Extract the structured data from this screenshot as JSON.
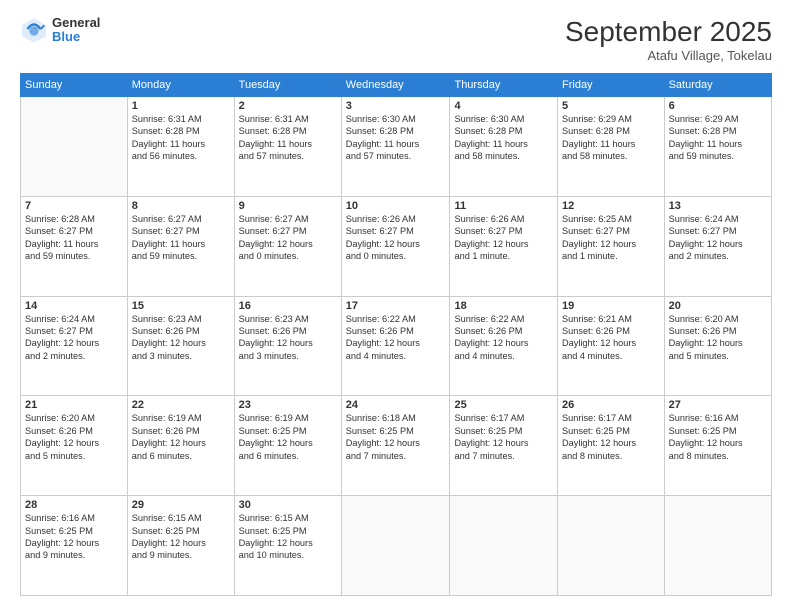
{
  "header": {
    "logo": {
      "general": "General",
      "blue": "Blue"
    },
    "title": "September 2025",
    "subtitle": "Atafu Village, Tokelau"
  },
  "weekdays": [
    "Sunday",
    "Monday",
    "Tuesday",
    "Wednesday",
    "Thursday",
    "Friday",
    "Saturday"
  ],
  "weeks": [
    [
      {
        "day": "",
        "info": ""
      },
      {
        "day": "1",
        "info": "Sunrise: 6:31 AM\nSunset: 6:28 PM\nDaylight: 11 hours\nand 56 minutes."
      },
      {
        "day": "2",
        "info": "Sunrise: 6:31 AM\nSunset: 6:28 PM\nDaylight: 11 hours\nand 57 minutes."
      },
      {
        "day": "3",
        "info": "Sunrise: 6:30 AM\nSunset: 6:28 PM\nDaylight: 11 hours\nand 57 minutes."
      },
      {
        "day": "4",
        "info": "Sunrise: 6:30 AM\nSunset: 6:28 PM\nDaylight: 11 hours\nand 58 minutes."
      },
      {
        "day": "5",
        "info": "Sunrise: 6:29 AM\nSunset: 6:28 PM\nDaylight: 11 hours\nand 58 minutes."
      },
      {
        "day": "6",
        "info": "Sunrise: 6:29 AM\nSunset: 6:28 PM\nDaylight: 11 hours\nand 59 minutes."
      }
    ],
    [
      {
        "day": "7",
        "info": "Sunrise: 6:28 AM\nSunset: 6:27 PM\nDaylight: 11 hours\nand 59 minutes."
      },
      {
        "day": "8",
        "info": "Sunrise: 6:27 AM\nSunset: 6:27 PM\nDaylight: 11 hours\nand 59 minutes."
      },
      {
        "day": "9",
        "info": "Sunrise: 6:27 AM\nSunset: 6:27 PM\nDaylight: 12 hours\nand 0 minutes."
      },
      {
        "day": "10",
        "info": "Sunrise: 6:26 AM\nSunset: 6:27 PM\nDaylight: 12 hours\nand 0 minutes."
      },
      {
        "day": "11",
        "info": "Sunrise: 6:26 AM\nSunset: 6:27 PM\nDaylight: 12 hours\nand 1 minute."
      },
      {
        "day": "12",
        "info": "Sunrise: 6:25 AM\nSunset: 6:27 PM\nDaylight: 12 hours\nand 1 minute."
      },
      {
        "day": "13",
        "info": "Sunrise: 6:24 AM\nSunset: 6:27 PM\nDaylight: 12 hours\nand 2 minutes."
      }
    ],
    [
      {
        "day": "14",
        "info": "Sunrise: 6:24 AM\nSunset: 6:27 PM\nDaylight: 12 hours\nand 2 minutes."
      },
      {
        "day": "15",
        "info": "Sunrise: 6:23 AM\nSunset: 6:26 PM\nDaylight: 12 hours\nand 3 minutes."
      },
      {
        "day": "16",
        "info": "Sunrise: 6:23 AM\nSunset: 6:26 PM\nDaylight: 12 hours\nand 3 minutes."
      },
      {
        "day": "17",
        "info": "Sunrise: 6:22 AM\nSunset: 6:26 PM\nDaylight: 12 hours\nand 4 minutes."
      },
      {
        "day": "18",
        "info": "Sunrise: 6:22 AM\nSunset: 6:26 PM\nDaylight: 12 hours\nand 4 minutes."
      },
      {
        "day": "19",
        "info": "Sunrise: 6:21 AM\nSunset: 6:26 PM\nDaylight: 12 hours\nand 4 minutes."
      },
      {
        "day": "20",
        "info": "Sunrise: 6:20 AM\nSunset: 6:26 PM\nDaylight: 12 hours\nand 5 minutes."
      }
    ],
    [
      {
        "day": "21",
        "info": "Sunrise: 6:20 AM\nSunset: 6:26 PM\nDaylight: 12 hours\nand 5 minutes."
      },
      {
        "day": "22",
        "info": "Sunrise: 6:19 AM\nSunset: 6:26 PM\nDaylight: 12 hours\nand 6 minutes."
      },
      {
        "day": "23",
        "info": "Sunrise: 6:19 AM\nSunset: 6:25 PM\nDaylight: 12 hours\nand 6 minutes."
      },
      {
        "day": "24",
        "info": "Sunrise: 6:18 AM\nSunset: 6:25 PM\nDaylight: 12 hours\nand 7 minutes."
      },
      {
        "day": "25",
        "info": "Sunrise: 6:17 AM\nSunset: 6:25 PM\nDaylight: 12 hours\nand 7 minutes."
      },
      {
        "day": "26",
        "info": "Sunrise: 6:17 AM\nSunset: 6:25 PM\nDaylight: 12 hours\nand 8 minutes."
      },
      {
        "day": "27",
        "info": "Sunrise: 6:16 AM\nSunset: 6:25 PM\nDaylight: 12 hours\nand 8 minutes."
      }
    ],
    [
      {
        "day": "28",
        "info": "Sunrise: 6:16 AM\nSunset: 6:25 PM\nDaylight: 12 hours\nand 9 minutes."
      },
      {
        "day": "29",
        "info": "Sunrise: 6:15 AM\nSunset: 6:25 PM\nDaylight: 12 hours\nand 9 minutes."
      },
      {
        "day": "30",
        "info": "Sunrise: 6:15 AM\nSunset: 6:25 PM\nDaylight: 12 hours\nand 10 minutes."
      },
      {
        "day": "",
        "info": ""
      },
      {
        "day": "",
        "info": ""
      },
      {
        "day": "",
        "info": ""
      },
      {
        "day": "",
        "info": ""
      }
    ]
  ]
}
